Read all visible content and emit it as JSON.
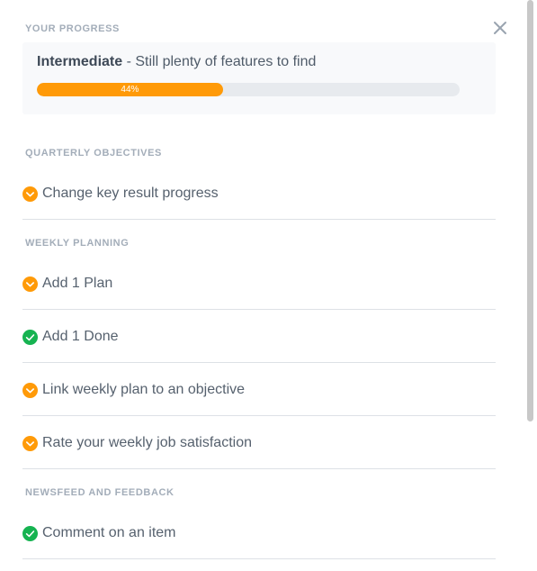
{
  "progress": {
    "section_label": "YOUR PROGRESS",
    "level": "Intermediate",
    "level_desc": " - Still plenty of features to find",
    "percent_label": "44%",
    "percent": 0.44
  },
  "close_icon": "close-icon",
  "colors": {
    "accent_orange": "#ff9a08",
    "done_green": "#16b351",
    "section_label": "#a3adb9"
  },
  "sections": [
    {
      "label": "QUARTERLY OBJECTIVES",
      "items": [
        {
          "label": "Change key result progress",
          "status": "todo",
          "icon": "chevron-down-icon"
        }
      ]
    },
    {
      "label": "WEEKLY PLANNING",
      "items": [
        {
          "label": "Add 1 Plan",
          "status": "todo",
          "icon": "chevron-down-icon"
        },
        {
          "label": "Add 1 Done",
          "status": "done",
          "icon": "check-icon"
        },
        {
          "label": "Link weekly plan to an objective",
          "status": "todo",
          "icon": "chevron-down-icon"
        },
        {
          "label": "Rate your weekly job satisfaction",
          "status": "todo",
          "icon": "chevron-down-icon"
        }
      ]
    },
    {
      "label": "NEWSFEED AND FEEDBACK",
      "items": [
        {
          "label": "Comment on an item",
          "status": "done",
          "icon": "check-icon"
        }
      ]
    }
  ]
}
